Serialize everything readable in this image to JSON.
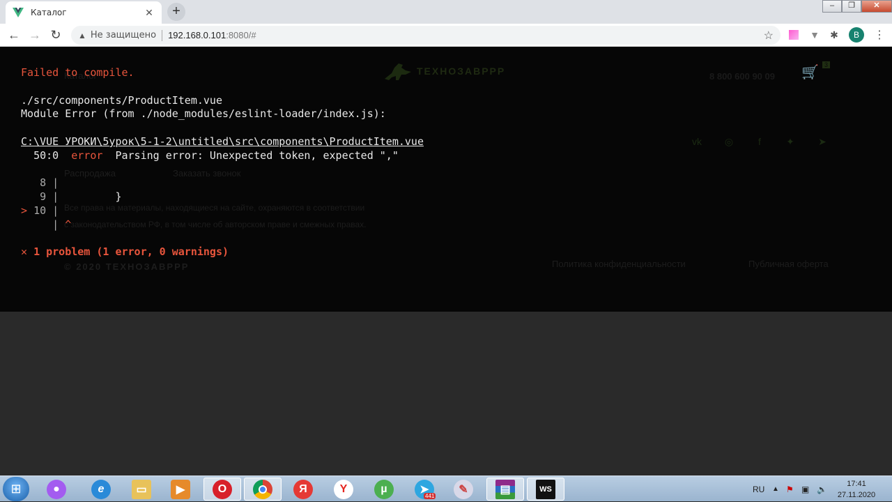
{
  "browser": {
    "tab_title": "Каталог",
    "not_secure": "Не защищено",
    "url_host": "192.168.0.101",
    "url_rest": ":8080/#",
    "profile_initial": "B"
  },
  "ghost_page": {
    "catalog": "Каталог",
    "logo_text": "ТЕХНОЗАВРРР",
    "phone": "8 800 600 90 09",
    "cart_count": "3",
    "sale_link": "Распродажа",
    "callback_link": "Заказать звонок",
    "copyright_line1": "Все права на материалы, находящиеся на сайте, охраняются в соответствии",
    "copyright_line2": "с законодательством РФ, в том числе об авторском праве и смежных правах.",
    "year_brand": "© 2020 ТЕХНОЗАВРРР",
    "privacy": "Политика конфиденциальности",
    "offer": "Публичная оферта"
  },
  "error_overlay": {
    "title": "Failed to compile.",
    "file": "./src/components/ProductItem.vue",
    "module_error": "Module Error (from ./node_modules/eslint-loader/index.js):",
    "path": "C:\\VUE УРОКИ\\5урок\\5-1-2\\untitled\\src\\components\\ProductItem.vue",
    "position": "50:0",
    "severity": "error",
    "message": "Parsing error: Unexpected token, expected \",\"",
    "line8": "8",
    "line9": "9",
    "line9_code": "}",
    "line10": "10",
    "caret": "^",
    "summary": "1 problem (1 error, 0 warnings)"
  },
  "taskbar": {
    "lang": "RU",
    "time": "17:41",
    "date": "27.11.2020",
    "telegram_badge": "441"
  }
}
